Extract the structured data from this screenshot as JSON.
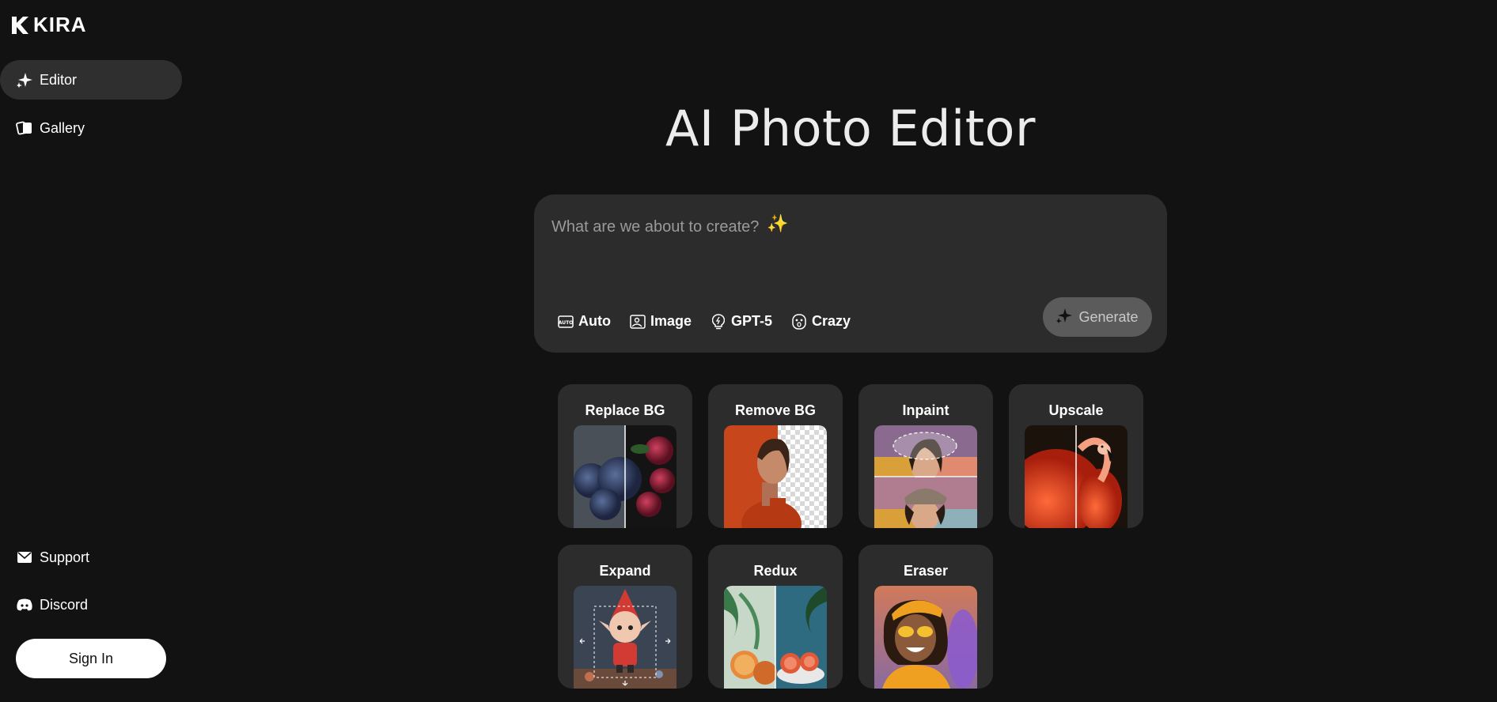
{
  "brand": {
    "name": "KIRA"
  },
  "sidebar": {
    "items": [
      {
        "label": "Editor",
        "icon": "sparkle-icon",
        "active": true
      },
      {
        "label": "Gallery",
        "icon": "gallery-icon",
        "active": false
      }
    ],
    "bottom": [
      {
        "label": "Support",
        "icon": "mail-icon"
      },
      {
        "label": "Discord",
        "icon": "discord-icon"
      }
    ],
    "sign_in": "Sign In"
  },
  "main": {
    "title": "AI Photo Editor",
    "prompt": {
      "placeholder": "What are we about to create?",
      "options": [
        {
          "label": "Auto",
          "icon": "auto-icon"
        },
        {
          "label": "Image",
          "icon": "image-icon"
        },
        {
          "label": "GPT-5",
          "icon": "bulb-icon"
        },
        {
          "label": "Crazy",
          "icon": "face-icon"
        }
      ],
      "generate": "Generate"
    },
    "tools": [
      {
        "label": "Replace BG"
      },
      {
        "label": "Remove BG"
      },
      {
        "label": "Inpaint"
      },
      {
        "label": "Upscale"
      },
      {
        "label": "Expand"
      },
      {
        "label": "Redux"
      },
      {
        "label": "Eraser"
      }
    ]
  },
  "colors": {
    "background": "#121212",
    "panel": "#2c2c2c",
    "active_nav": "#2f2f2f",
    "generate_bg": "#5b5b5b"
  }
}
